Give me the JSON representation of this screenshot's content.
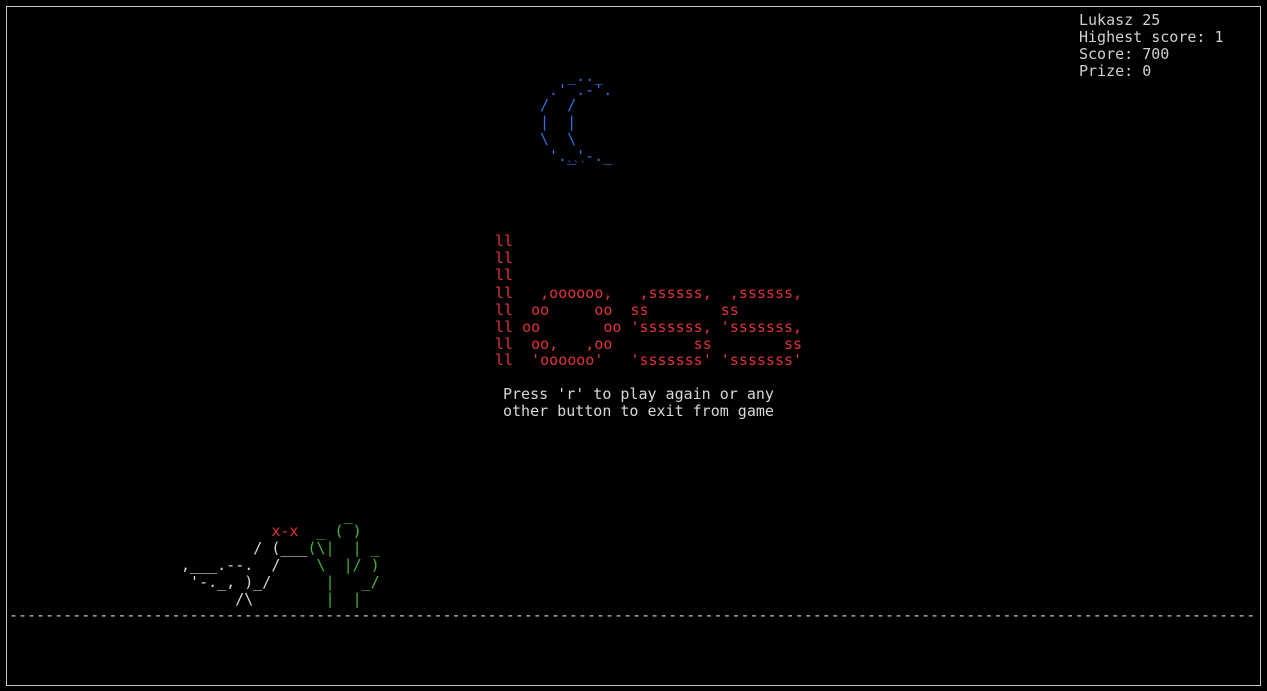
{
  "scoreboard": {
    "player": "Lukasz 25",
    "highest_score": "Highest score: 1",
    "score": "Score: 700",
    "prize": "Prize: 0"
  },
  "moon_art": [
    "   _.._",
    " .' .-'.",
    "/  /",
    "|  |",
    "\\  \\",
    " '._'-._",
    "    ```"
  ],
  "game_over_art": [
    "ll",
    "ll",
    "ll",
    "ll   ,oooooo,   ,ssssss,  ,ssssss,",
    "ll  oo     oo  ss        ss",
    "ll oo       oo 'sssssss, 'sssssss,",
    "ll  oo,   ,oo         ss        ss",
    "ll  'oooooo'   'sssssss' 'sssssss'"
  ],
  "message": [
    "Press 'r' to play again or any",
    "other button to exit from game"
  ],
  "dino_art": [
    {
      "white": "",
      "red": "",
      "green": "                   _"
    },
    {
      "white": "",
      "red": "           x-x",
      "green": "  _ ( )"
    },
    {
      "white": "         / (___",
      "red": "",
      "green": "(\\|  | _"
    },
    {
      "white": " ,___.--.  /",
      "red": "",
      "green": "    \\  |/ )"
    },
    {
      "white": "  '-._, )_/",
      "red": "",
      "green": "      |   _/"
    },
    {
      "white": "       /\\",
      "red": "",
      "green": "        |  |"
    }
  ],
  "ground": "--------------------------------------------------------------------------------------------------------------------------------------------------",
  "colors": {
    "background": "#000000",
    "text": "#d0d0d0",
    "logo": "#e0323c",
    "cactus": "#3fb53f",
    "moon": "#2f6fe0"
  }
}
